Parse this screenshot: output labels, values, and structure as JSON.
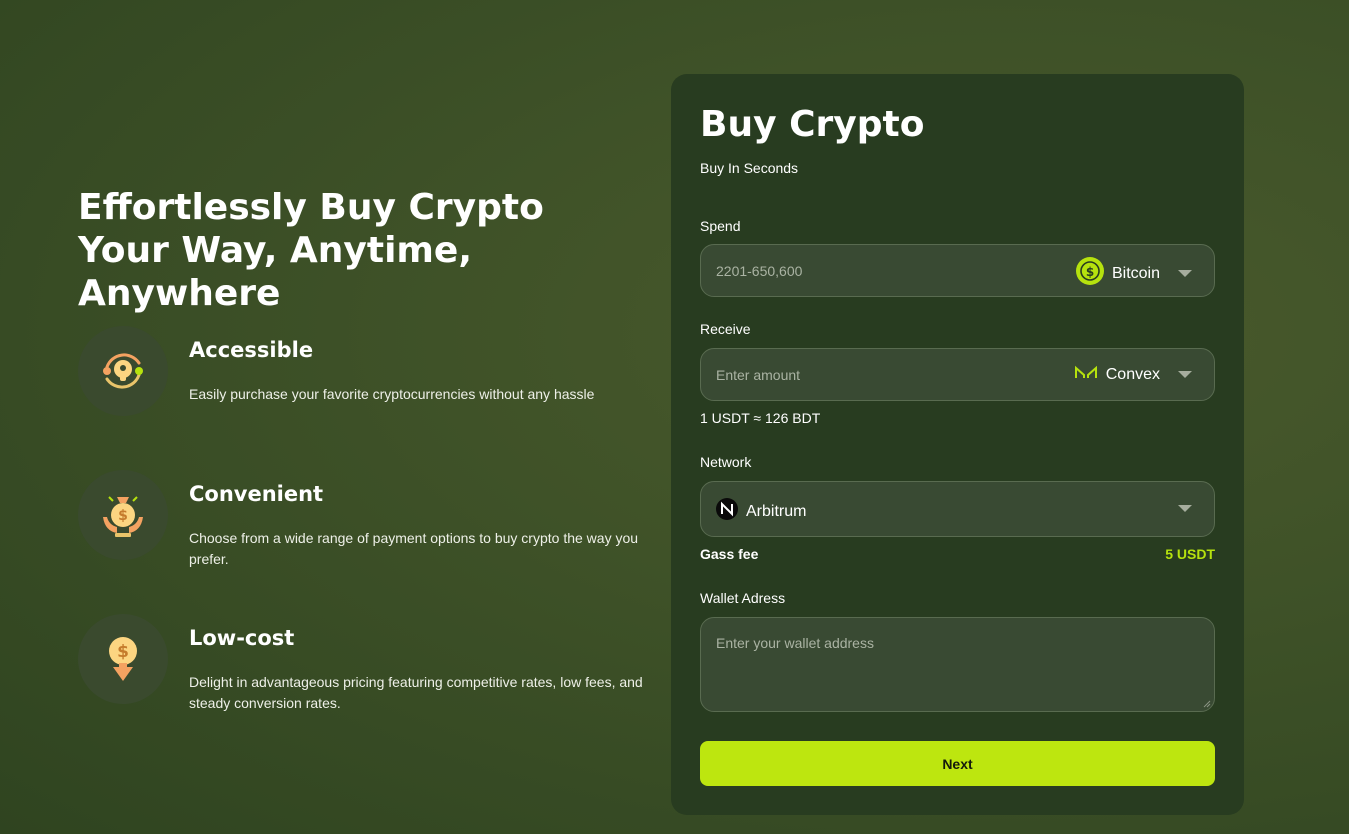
{
  "hero": {
    "headline": "Effortlessly Buy Crypto Your Way, Anytime, Anywhere"
  },
  "features": [
    {
      "icon": "unlock-icon",
      "title": "Accessible",
      "description": "Easily purchase your favorite cryptocurrencies without any hassle"
    },
    {
      "icon": "money-bag-hands-icon",
      "title": "Convenient",
      "description": "Choose from a wide range of payment options to buy crypto the way you prefer."
    },
    {
      "icon": "dollar-down-icon",
      "title": "Low-cost",
      "description": "Delight in advantageous pricing featuring competitive rates, low fees, and steady conversion rates."
    }
  ],
  "card": {
    "title": "Buy Crypto",
    "subtitle": "Buy In Seconds",
    "spend": {
      "label": "Spend",
      "placeholder": "2201-650,600",
      "currency": "Bitcoin",
      "currency_icon": "usdc-coin-icon"
    },
    "receive": {
      "label": "Receive",
      "placeholder": "Enter amount",
      "currency": "Convex",
      "currency_icon": "maker-logo-icon"
    },
    "rate": "1 USDT ≈ 126 BDT",
    "network": {
      "label": "Network",
      "value": "Arbitrum",
      "icon": "near-logo-icon"
    },
    "gas": {
      "label": "Gass fee",
      "value": "5 USDT"
    },
    "wallet": {
      "label": "Wallet Adress",
      "placeholder": "Enter your wallet address"
    },
    "next_label": "Next"
  },
  "colors": {
    "accent": "#bde60f",
    "card_bg": "#283c20",
    "field_bg": "#394a33"
  }
}
